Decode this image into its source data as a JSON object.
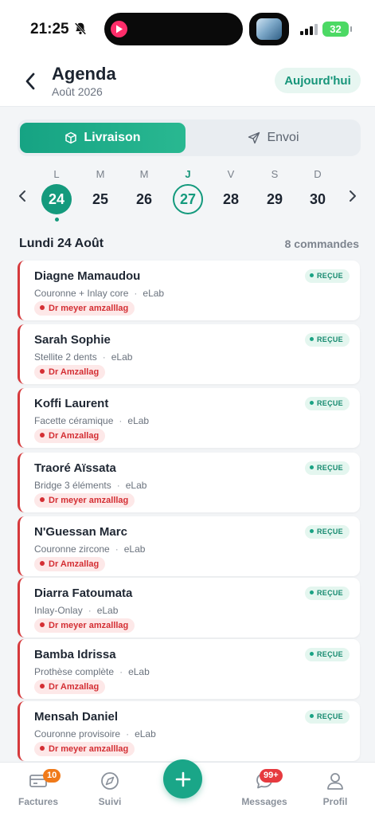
{
  "status_bar": {
    "time": "21:25",
    "battery": "32"
  },
  "header": {
    "title": "Agenda",
    "subtitle": "Août 2026",
    "today_button": "Aujourd'hui"
  },
  "mode_toggle": {
    "active": "Livraison",
    "inactive": "Envoi"
  },
  "week": {
    "days": [
      {
        "weekday": "L",
        "date": "24",
        "state": "selected"
      },
      {
        "weekday": "M",
        "date": "25",
        "state": "normal"
      },
      {
        "weekday": "M",
        "date": "26",
        "state": "normal"
      },
      {
        "weekday": "J",
        "date": "27",
        "state": "today"
      },
      {
        "weekday": "V",
        "date": "28",
        "state": "normal"
      },
      {
        "weekday": "S",
        "date": "29",
        "state": "normal"
      },
      {
        "weekday": "D",
        "date": "30",
        "state": "normal"
      }
    ]
  },
  "section": {
    "title": "Lundi 24 Août",
    "count": "8 commandes"
  },
  "orders": [
    {
      "name": "Diagne Mamaudou",
      "work": "Couronne + Inlay core",
      "lab": "eLab",
      "doctor": "Dr meyer amzalllag",
      "status": "REÇUE"
    },
    {
      "name": "Sarah Sophie",
      "work": "Stellite 2 dents",
      "lab": "eLab",
      "doctor": "Dr Amzallag",
      "status": "REÇUE"
    },
    {
      "name": "Koffi Laurent",
      "work": "Facette céramique",
      "lab": "eLab",
      "doctor": "Dr Amzallag",
      "status": "REÇUE"
    },
    {
      "name": "Traoré Aïssata",
      "work": "Bridge 3 éléments",
      "lab": "eLab",
      "doctor": "Dr meyer amzalllag",
      "status": "REÇUE"
    },
    {
      "name": "N'Guessan Marc",
      "work": "Couronne zircone",
      "lab": "eLab",
      "doctor": "Dr Amzallag",
      "status": "REÇUE"
    },
    {
      "name": "Diarra Fatoumata",
      "work": "Inlay-Onlay",
      "lab": "eLab",
      "doctor": "Dr meyer amzalllag",
      "status": "REÇUE"
    },
    {
      "name": "Bamba Idrissa",
      "work": "Prothèse complète",
      "lab": "eLab",
      "doctor": "Dr Amzallag",
      "status": "REÇUE"
    },
    {
      "name": "Mensah Daniel",
      "work": "Couronne provisoire",
      "lab": "eLab",
      "doctor": "Dr meyer amzalllag",
      "status": "REÇUE"
    }
  ],
  "tabbar": {
    "factures": {
      "label": "Factures",
      "badge": "10"
    },
    "suivi": {
      "label": "Suivi"
    },
    "messages": {
      "label": "Messages",
      "badge": "99+"
    },
    "profil": {
      "label": "Profil"
    }
  },
  "colors": {
    "accent": "#149a7d",
    "danger": "#d42f34",
    "badge_orange": "#f07a1a",
    "badge_red": "#e63a3f"
  }
}
